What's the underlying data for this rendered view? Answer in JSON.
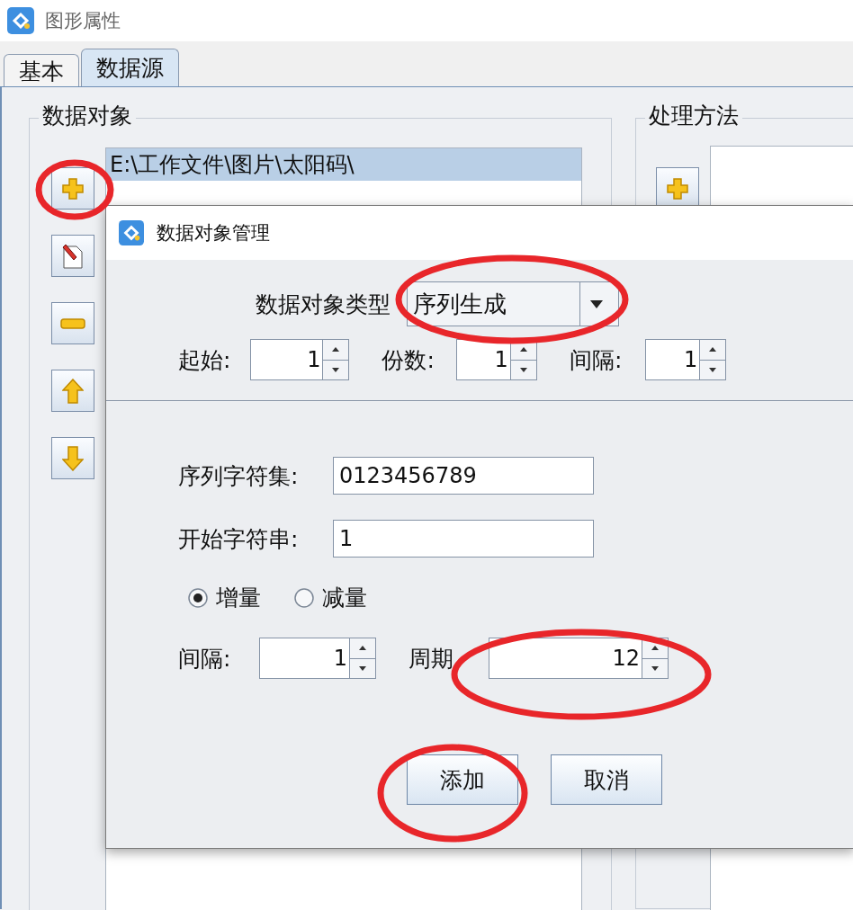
{
  "window": {
    "title": "图形属性"
  },
  "tabs": [
    {
      "label": "基本",
      "selected": false
    },
    {
      "label": "数据源",
      "selected": true
    }
  ],
  "data_objects": {
    "title": "数据对象",
    "items": [
      {
        "text": "E:\\工作文件\\图片\\太阳码\\",
        "selected": true
      }
    ]
  },
  "processing": {
    "title": "处理方法"
  },
  "dialog": {
    "title": "数据对象管理",
    "type_label": "数据对象类型",
    "type_value": "序列生成",
    "spinners": [
      {
        "label": "起始:",
        "value": "1"
      },
      {
        "label": "份数:",
        "value": "1"
      },
      {
        "label": "间隔:",
        "value": "1"
      }
    ],
    "fields": [
      {
        "label": "序列字符集:",
        "value": "0123456789"
      },
      {
        "label": "开始字符串:",
        "value": "1"
      }
    ],
    "radios": [
      {
        "label": "增量",
        "selected": true
      },
      {
        "label": "减量",
        "selected": false
      }
    ],
    "interval": {
      "label": "间隔:",
      "value": "1"
    },
    "period": {
      "label": "周期",
      "value": "12"
    },
    "buttons": [
      {
        "label": "添加"
      },
      {
        "label": "取消"
      }
    ]
  }
}
